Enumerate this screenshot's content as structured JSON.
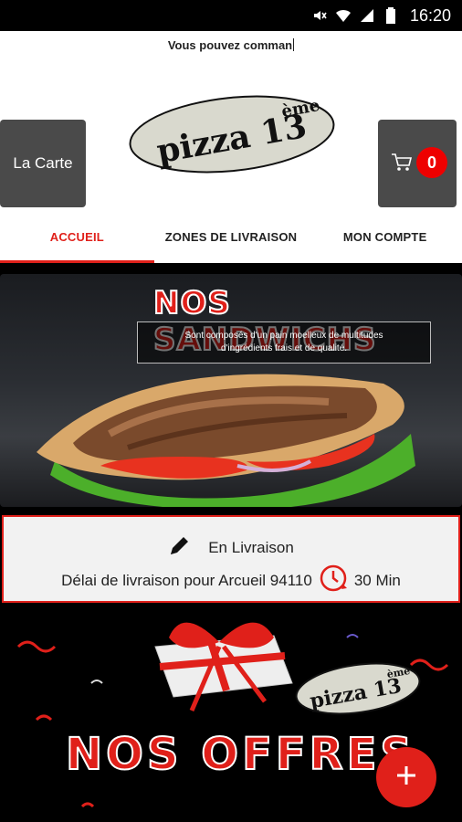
{
  "status_bar": {
    "time": "16:20",
    "icons": [
      "mute-icon",
      "wifi-icon",
      "signal-icon",
      "battery-icon"
    ]
  },
  "marquee_text": "Vous pouvez comman",
  "header": {
    "menu_button_label": "La Carte",
    "cart_count": "0",
    "logo_text": "pizza 13",
    "logo_sup": "ème"
  },
  "tabs": [
    {
      "label": "ACCUEIL",
      "active": true
    },
    {
      "label": "ZONES DE LIVRAISON",
      "active": false
    },
    {
      "label": "MON COMPTE",
      "active": false
    }
  ],
  "banner": {
    "title": "NOS SANDWICHS",
    "subtitle": "Sont composés d'un pain moelleux de multitudes d'ingrédients frais et de qualité."
  },
  "delivery": {
    "mode": "En Livraison",
    "delay_text": "Délai de livraison pour Arcueil 94110",
    "delay_value": "30 Min"
  },
  "offers": {
    "title": "NOS OFFRES",
    "logo_text": "pizza 13",
    "logo_sup": "ème"
  },
  "colors": {
    "accent": "#e0201a",
    "dark_button": "#4a4a4a"
  }
}
